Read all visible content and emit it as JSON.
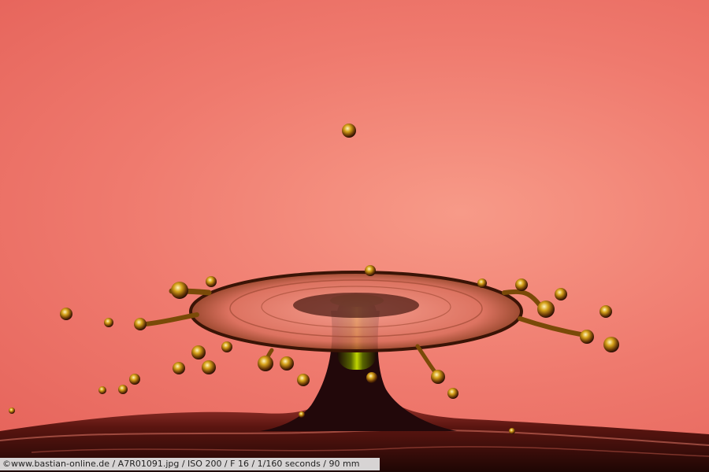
{
  "photo": {
    "subject": "water-drop-splash",
    "colors": {
      "background_light": "#f79a88",
      "background_mid": "#ef7a6e",
      "background_dark": "#e0564f",
      "water_dark": "#2b0c08",
      "droplet_gold": "#b8860b",
      "column_green": "#9fbf00"
    }
  },
  "caption": {
    "text": "©www.bastian-online.de / A7R01091.jpg / ISO 200 / F 16 / 1/160 seconds  / 90 mm"
  }
}
